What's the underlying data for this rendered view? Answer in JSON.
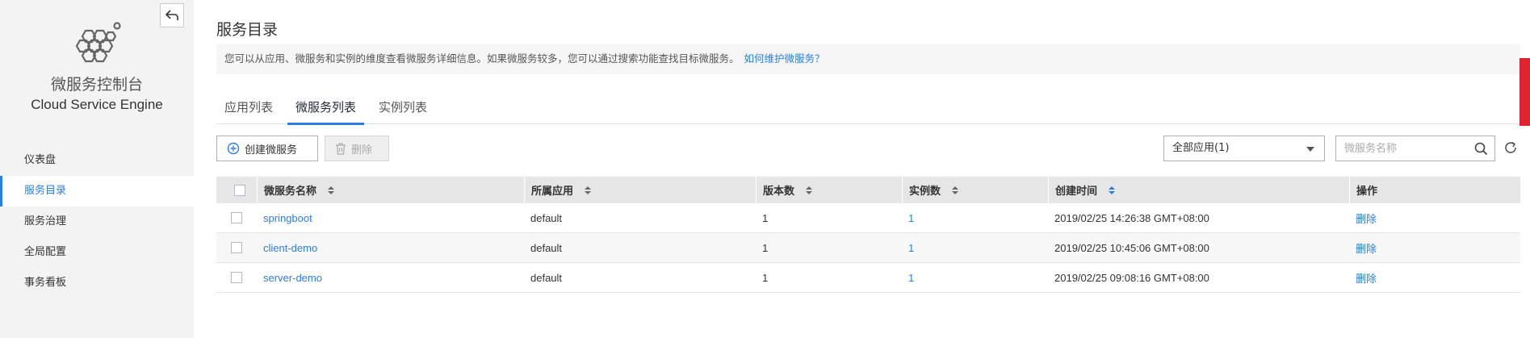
{
  "sidebar": {
    "brand_cn": "微服务控制台",
    "brand_en": "Cloud Service Engine",
    "items": [
      {
        "label": "仪表盘"
      },
      {
        "label": "服务目录"
      },
      {
        "label": "服务治理"
      },
      {
        "label": "全局配置"
      },
      {
        "label": "事务看板"
      }
    ]
  },
  "main": {
    "title": "服务目录",
    "info": "您可以从应用、微服务和实例的维度查看微服务详细信息。如果微服务较多，您可以通过搜索功能查找目标微服务。",
    "info_link": "如何维护微服务？",
    "tabs": [
      {
        "label": "应用列表"
      },
      {
        "label": "微服务列表"
      },
      {
        "label": "实例列表"
      }
    ],
    "toolbar": {
      "create_label": "创建微服务",
      "delete_label": "删除",
      "app_filter": "全部应用(1)",
      "search_placeholder": "微服务名称"
    },
    "table": {
      "headers": [
        "微服务名称",
        "所属应用",
        "版本数",
        "实例数",
        "创建时间",
        "操作"
      ],
      "rows": [
        {
          "name": "springboot",
          "app": "default",
          "versions": "1",
          "instances": "1",
          "created": "2019/02/25 14:26:38 GMT+08:00",
          "action": "删除"
        },
        {
          "name": "client-demo",
          "app": "default",
          "versions": "1",
          "instances": "1",
          "created": "2019/02/25 10:45:06 GMT+08:00",
          "action": "删除"
        },
        {
          "name": "server-demo",
          "app": "default",
          "versions": "1",
          "instances": "1",
          "created": "2019/02/25 09:08:16 GMT+08:00",
          "action": "删除"
        }
      ]
    }
  },
  "colors": {
    "accent": "#2a7ee6",
    "sidebar_bg": "#f3f3f3",
    "header_bg": "#e6e6e6",
    "feedback_tab": "#e0242e"
  }
}
